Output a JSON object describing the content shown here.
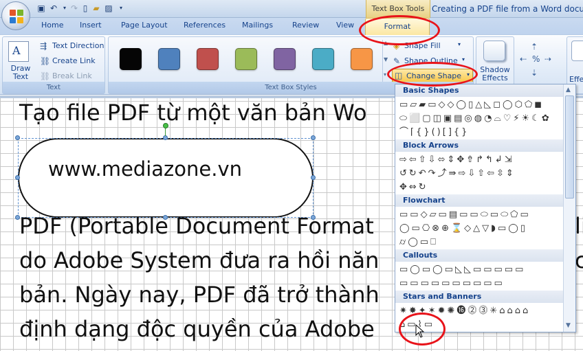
{
  "window": {
    "doc_title": "Creating a PDF file from a Word documen",
    "contextual_tools_title": "Text Box Tools"
  },
  "tabs": [
    "Home",
    "Insert",
    "Page Layout",
    "References",
    "Mailings",
    "Review",
    "View"
  ],
  "active_tab": "Format",
  "ribbon": {
    "text_group": {
      "label": "Text",
      "draw_text_box": "Draw Text Box",
      "text_direction": "Text Direction",
      "create_link": "Create Link",
      "break_link": "Break Link"
    },
    "styles_group": {
      "label": "Text Box Styles",
      "swatches": [
        "#050505",
        "#4f81bd",
        "#c0504d",
        "#9bbb59",
        "#8064a2",
        "#4bacc6",
        "#f79646"
      ],
      "shape_fill": "Shape Fill",
      "shape_outline": "Shape Outline",
      "change_shape": "Change Shape"
    },
    "shadow_group": {
      "label": "Shadow Effects"
    },
    "effects_partial": "Effe"
  },
  "document": {
    "line1": "Tạo file PDF từ một văn bản Wo",
    "pill_text": "www.mediazone.vn",
    "line2": "PDF (Portable Document Format",
    "line2_tail": "li",
    "line3": "do Adobe System đưa ra hồi năn",
    "line3_tail": "c",
    "line4": "bản. Ngày nay, PDF đã trở thành",
    "line5": "định dạng độc quyền của Adobe"
  },
  "dropdown": {
    "sections": [
      {
        "title": "Basic Shapes",
        "rows": [
          "▭▱▰▭◇◇◯▯△◺◻◯⬡⬠◼",
          "⬭⬜▢◫▣▤◎◍◔⌓♡⚡☀☾✿",
          "⌒⌈{}()[]{}"
        ]
      },
      {
        "title": "Block Arrows",
        "rows": [
          "⇨⇦⇧⇩⬄⇕✥⇮↱↰↲⇲",
          "↺↻↶↷⤴⇛⇨⇩⇧⇦⇳⇕",
          "✥⇔↻"
        ]
      },
      {
        "title": "Flowchart",
        "rows": [
          "▭▭◇▱▭▤▭▭⬭▭⬭⬠▭",
          "◯▭⎔⊗⊕⌛◇△▽◗▭◯▯",
          "⌭◯▭⎕"
        ]
      },
      {
        "title": "Callouts",
        "rows": [
          "▭◯▭◯▭◺◺▭▭▭▭▭",
          "▭▭▭▭▭▭▭▭▭▭"
        ]
      },
      {
        "title": "Stars and Banners",
        "rows": [
          "✷✸✦✶✹✺⓰⓶⓷✳⌂⌂⌂⌂",
          "⌂▭⌇▭"
        ]
      }
    ]
  },
  "colors": {
    "highlight": "#e8131a",
    "ribbon_tab_text": "#15428b",
    "section_header_text": "#15428b"
  }
}
